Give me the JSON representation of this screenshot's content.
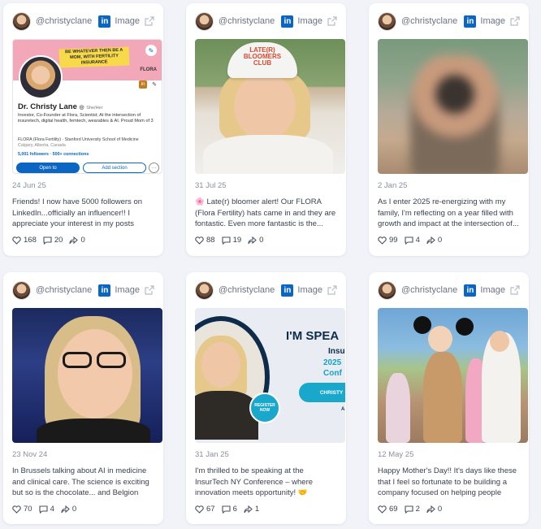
{
  "accent_color": "#0a66c2",
  "cards": [
    {
      "handle": "@christyclane",
      "type_label": "Image",
      "date": "24 Jun 25",
      "caption": "Friends! I now have 5000 followers on LinkedIn...officially an influencer!! I appreciate your interest in my posts and...",
      "likes": "168",
      "comments": "20",
      "shares": "0"
    },
    {
      "handle": "@christyclane",
      "type_label": "Image",
      "date": "31 Jul 25",
      "caption": "🌸 Late(r) bloomer alert! Our FLORA (Flora Fertility) hats came in and they are fontastic. Even more fantastic is the...",
      "likes": "88",
      "comments": "19",
      "shares": "0"
    },
    {
      "handle": "@christyclane",
      "type_label": "Image",
      "date": "2 Jan 25",
      "caption": "As I enter 2025 re-energizing with my family, I'm reflecting on a year filled with growth and impact at the intersection of...",
      "likes": "99",
      "comments": "4",
      "shares": "0"
    },
    {
      "handle": "@christyclane",
      "type_label": "Image",
      "date": "23 Nov 24",
      "caption": "In Brussels talking about AI in medicine and clinical care. The science is exciting but so is the chocolate... and Belgion bee...",
      "likes": "70",
      "comments": "4",
      "shares": "0"
    },
    {
      "handle": "@christyclane",
      "type_label": "Image",
      "date": "31 Jan 25",
      "caption": "I'm thrilled to be speaking at the InsurTech NY Conference – where innovation meets opportunity! 🤝 Connect with traditional...",
      "likes": "67",
      "comments": "6",
      "shares": "1"
    },
    {
      "handle": "@christyclane",
      "type_label": "Image",
      "date": "12 May 25",
      "caption": "Happy Mother's Day!! It's days like these that I feel so fortunate to be building a company focused on helping people gro...",
      "likes": "69",
      "comments": "2",
      "shares": "0"
    }
  ],
  "profile_media": {
    "banner_text": "BE WHATEVER THEN BE A MOM, WITH FERTILITY INSURANCE",
    "flora": "FLORA",
    "name": "Dr. Christy Lane",
    "pronouns": "She/Her",
    "bio": "Investor, Co-Founder at Flora, Scientist; At the intersection of insuretech, digital health, femtech, wearables & AI. Proud Mom of 3",
    "education": "FLORA (Flora Fertility) · Stanford University School of Medicine",
    "location": "Calgary, Alberta, Canada",
    "connections": "5,001 followers · 500+ connections",
    "open_to": "Open to",
    "add_section": "Add section",
    "more": "···"
  },
  "hat_media": {
    "hat_text": "LATE(R) BLOOMERS CLUB"
  },
  "conf_media": {
    "title": "I'M SPEA",
    "line1": "Insu",
    "line2": "2025",
    "line3": "Conf",
    "pill": "CHRISTY",
    "register": "REGISTER NOW",
    "a": "A"
  }
}
